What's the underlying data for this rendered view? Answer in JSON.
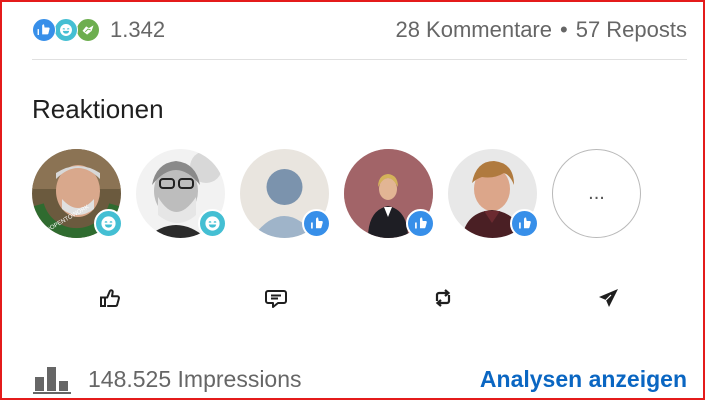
{
  "social": {
    "reaction_count": "1.342",
    "reaction_types": [
      "like-icon",
      "funny-icon",
      "support-icon"
    ],
    "comments": "28 Kommentare",
    "separator": "•",
    "reposts": "57 Reposts"
  },
  "reactions_section": {
    "heading": "Reaktionen",
    "avatars": [
      {
        "photo_note": "#OPENTOWORK",
        "reaction": "funny"
      },
      {
        "reaction": "funny"
      },
      {
        "reaction": "like"
      },
      {
        "reaction": "like"
      },
      {
        "reaction": "like"
      }
    ],
    "more_label": "..."
  },
  "actions": [
    "like-icon",
    "comment-icon",
    "repost-icon",
    "send-icon"
  ],
  "footer": {
    "impressions": "148.525 Impressions",
    "analytics_link": "Analysen anzeigen"
  },
  "colors": {
    "like": "#378fe9",
    "funny": "#44bfd3",
    "support": "#6dae4f",
    "link": "#0a66c2",
    "frame": "#e41b1b"
  }
}
